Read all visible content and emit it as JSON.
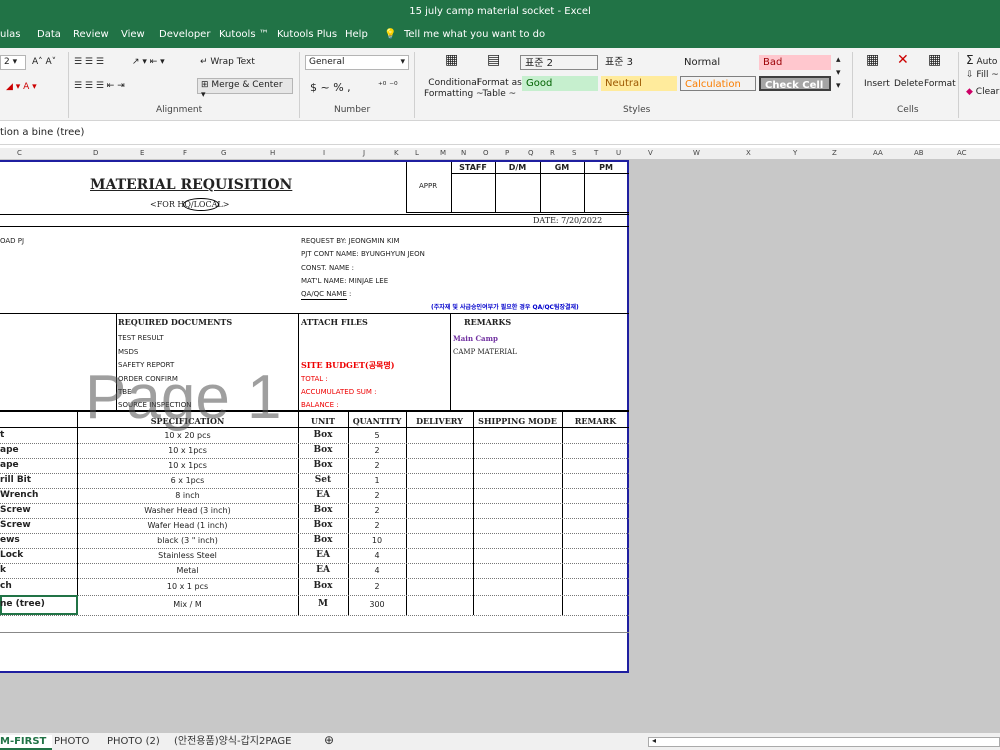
{
  "window": {
    "title": "15 july camp material socket  -  Excel"
  },
  "menu": [
    "ulas",
    "Data",
    "Review",
    "View",
    "Developer",
    "Kutools ™",
    "Kutools Plus",
    "Help",
    "Tell me what you want to do"
  ],
  "ribbon": {
    "font_size": "2",
    "wrap_text": "Wrap Text",
    "merge_center": "Merge & Center",
    "number_format": "General",
    "number_symbols": "$  ~  %  ,",
    "conditional": [
      "Conditional",
      "Formatting ~"
    ],
    "format_as": [
      "Format as",
      "Table ~"
    ],
    "styles": [
      {
        "label": "표준 2",
        "bg": "#ffffff",
        "color": "#222"
      },
      {
        "label": "표준 3",
        "bg": "#ffffff",
        "color": "#222"
      },
      {
        "label": "Normal",
        "bg": "#ffffff",
        "color": "#222"
      },
      {
        "label": "Bad",
        "bg": "#ffc7ce",
        "color": "#9c0006"
      },
      {
        "label": "Good",
        "bg": "#c6efce",
        "color": "#006100"
      },
      {
        "label": "Neutral",
        "bg": "#ffeb9c",
        "color": "#9c5700"
      },
      {
        "label": "Calculation",
        "bg": "#f2f2f2",
        "color": "#fa7d00"
      },
      {
        "label": "Check Cell",
        "bg": "#a5a5a5",
        "color": "#ffffff"
      }
    ],
    "cells_btns": [
      "Insert",
      "Delete",
      "Format"
    ],
    "editing": [
      "Auto",
      "Fill ~",
      "Clear"
    ],
    "groups": {
      "alignment": "Alignment",
      "number": "Number",
      "styles": "Styles",
      "cells": "Cells"
    }
  },
  "formula": {
    "content": "tion a bine (tree)"
  },
  "columns": [
    "C",
    "D",
    "E",
    "F",
    "G",
    "H",
    "I",
    "J",
    "K",
    "L",
    "M",
    "N",
    "O",
    "P",
    "Q",
    "R",
    "S",
    "T",
    "U",
    "V",
    "W",
    "X",
    "Y",
    "Z",
    "AA",
    "AB",
    "AC"
  ],
  "form": {
    "title": "MATERIAL  REQUISITION",
    "subtitle": "<FOR HQ/LOCAL>",
    "appr": "APPR",
    "appr_cols": [
      "STAFF",
      "D/M",
      "GM",
      "PM"
    ],
    "date": "DATE:   7/20/2022",
    "project_frag": "OAD PJ",
    "request_info": [
      "REQUEST BY:  JEONGMIN KIM",
      "PJT CONT NAME: BYUNGHYUN JEON",
      "CONST. NAME :",
      "MAT'L NAME:  MINJAE LEE",
      "QA/QC NAME :"
    ],
    "korean_note": "(주자재 및 사급승인여부가 필요한 경우 QA/QC팀장결재)",
    "req_docs_header": "REQUIRED DOCUMENTS",
    "req_docs": [
      "TEST RESULT",
      "MSDS",
      "SAFETY REPORT",
      "ORDER CONFIRM",
      "TBE",
      "SOURCE INSPECTION"
    ],
    "attach_header": "ATTACH FILES",
    "budget_title": "SITE BUDGET(공목명)",
    "budget_lines": [
      "TOTAL :",
      "ACCUMULATED SUM :",
      "BALANCE :"
    ],
    "remarks_header": "REMARKS",
    "remarks": [
      "Main Camp",
      "CAMP MATERIAL"
    ],
    "table_headers": [
      "SPECIFICATION",
      "UNIT",
      "QUANTITY",
      "DELIVERY",
      "SHIPPING MODE",
      "REMARK"
    ],
    "items": [
      {
        "name": "t",
        "spec": "10 x 20 pcs",
        "unit": "Box",
        "qty": "5"
      },
      {
        "name": "ape",
        "spec": "10 x 1pcs",
        "unit": "Box",
        "qty": "2"
      },
      {
        "name": "ape",
        "spec": "10 x 1pcs",
        "unit": "Box",
        "qty": "2"
      },
      {
        "name": "rill Bit",
        "spec": "6 x 1pcs",
        "unit": "Set",
        "qty": "1"
      },
      {
        "name": "Wrench",
        "spec": "8 inch",
        "unit": "EA",
        "qty": "2"
      },
      {
        "name": "Screw",
        "spec": "Washer Head (3 inch)",
        "unit": "Box",
        "qty": "2"
      },
      {
        "name": "Screw",
        "spec": "Wafer Head (1 inch)",
        "unit": "Box",
        "qty": "2"
      },
      {
        "name": "ews",
        "spec": "black (3 \" inch)",
        "unit": "Box",
        "qty": "10"
      },
      {
        "name": "Lock",
        "spec": "Stainless Steel",
        "unit": "EA",
        "qty": "4"
      },
      {
        "name": "k",
        "spec": "Metal",
        "unit": "EA",
        "qty": "4"
      },
      {
        "name": "ch",
        "spec": "10 x 1 pcs",
        "unit": "Box",
        "qty": "2"
      },
      {
        "name": "ne (tree)",
        "spec": "Mix / M",
        "unit": "M",
        "qty": "300"
      }
    ],
    "watermark": "Page 1"
  },
  "tabs": [
    {
      "label": "M-FIRST",
      "active": true
    },
    {
      "label": "PHOTO",
      "active": false
    },
    {
      "label": "PHOTO (2)",
      "active": false
    },
    {
      "label": "(안전용품)양식-갑지2PAGE",
      "active": false
    }
  ]
}
